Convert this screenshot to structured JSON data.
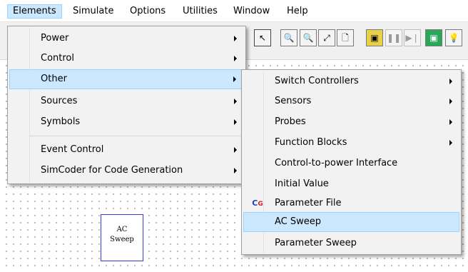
{
  "menubar": [
    {
      "label": "Elements",
      "active": true
    },
    {
      "label": "Simulate"
    },
    {
      "label": "Options"
    },
    {
      "label": "Utilities"
    },
    {
      "label": "Window"
    },
    {
      "label": "Help"
    }
  ],
  "toolbar": [
    {
      "icon": "select-pointer-icon",
      "glyph": "↖"
    },
    {
      "icon": "zoom-in-icon",
      "glyph": "🔍"
    },
    {
      "icon": "zoom-out-icon",
      "glyph": "🔍"
    },
    {
      "icon": "fit-view-icon",
      "glyph": "⤢"
    },
    {
      "icon": "page-icon",
      "glyph": "🗋"
    },
    {
      "icon": "run-simulation-icon",
      "glyph": "▣"
    },
    {
      "icon": "pause-icon",
      "glyph": "❚❚"
    },
    {
      "icon": "step-icon",
      "glyph": "▶❘"
    },
    {
      "icon": "scope-icon",
      "glyph": "▣"
    },
    {
      "icon": "light-bulb-icon",
      "glyph": "💡"
    }
  ],
  "elements_menu": {
    "items": [
      {
        "label": "Power",
        "submenu": true
      },
      {
        "label": "Control",
        "submenu": true
      },
      {
        "label": "Other",
        "submenu": true,
        "highlighted": true
      },
      {
        "label": "Sources",
        "submenu": true
      },
      {
        "label": "Symbols",
        "submenu": true
      },
      {
        "label": "Event Control",
        "submenu": true
      },
      {
        "label": "SimCoder for Code Generation",
        "submenu": true
      }
    ]
  },
  "other_submenu": {
    "items": [
      {
        "label": "Switch Controllers",
        "submenu": true
      },
      {
        "label": "Sensors",
        "submenu": true
      },
      {
        "label": "Probes",
        "submenu": true
      },
      {
        "label": "Function Blocks",
        "submenu": true
      },
      {
        "label": "Control-to-power Interface"
      },
      {
        "label": "Initial Value"
      },
      {
        "label": "Parameter File",
        "icon": "parameter-file-icon",
        "icon_glyph": "CG"
      },
      {
        "label": "AC Sweep",
        "highlighted": true
      },
      {
        "label": "Parameter Sweep"
      }
    ]
  },
  "canvas_block": {
    "line1": "AC",
    "line2": "Sweep"
  },
  "colors": {
    "highlight": "#cce8ff",
    "highlight_border": "#99d1ff",
    "block_border": "#3b3bd6"
  }
}
